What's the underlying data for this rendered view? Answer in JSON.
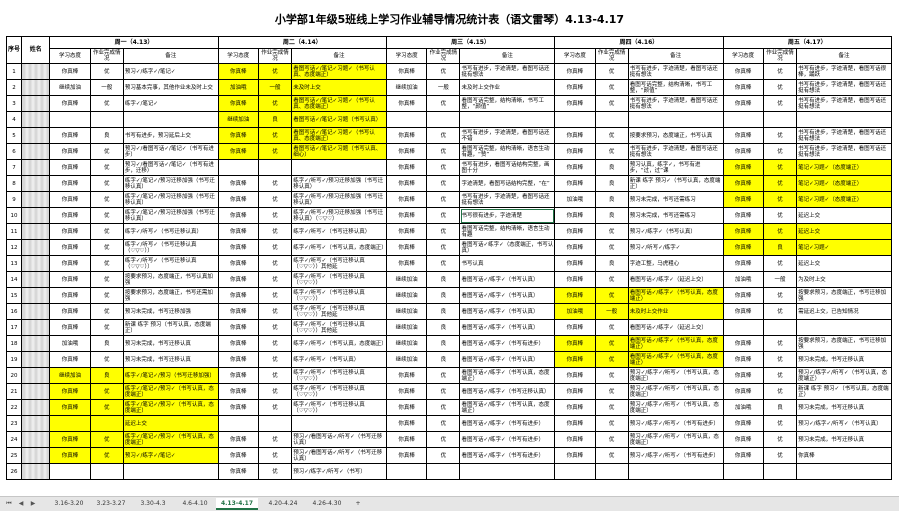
{
  "title": "小学部1年级5班线上学习作业辅导情况统计表（语文雷琴）4.13-4.17",
  "header": {
    "seq": "序号",
    "name": "姓名",
    "days": [
      "周一（4.13）",
      "周二（4.14）",
      "周三（4.15）",
      "周四（4.16）",
      "周五（4.17）"
    ],
    "sub": [
      "学习态度",
      "作业完成情况",
      "备注"
    ]
  },
  "rows": [
    {
      "no": "1",
      "cells": [
        [
          "你真棒",
          "优",
          "预习✓/练字✓/笔记✓"
        ],
        [
          "你真棒",
          "优",
          "看图写话✓/笔记✓习题✓（书写认真、态度端正）"
        ],
        [
          "你真棒",
          "优",
          "书写有进步，字迹清楚，看图写话还挺有想法"
        ],
        [
          "你真棒",
          "优",
          "书写有进步，字迹清楚，看图写话还挺有想法"
        ],
        [
          "你真棒",
          "优",
          "书写有进步，字迹清楚，看图写话很棒，踊跃"
        ]
      ]
    },
    {
      "no": "2",
      "cells": [
        [
          "继续加油",
          "一般",
          "预习基本完事，其他作业未及时上交"
        ],
        [
          "加油哦",
          "一般",
          "未及时上交"
        ],
        [
          "继续加油",
          "一般",
          "未及时上交作业"
        ],
        [
          "你真棒",
          "优",
          "看图写话完整，结构清晰，书写工整，“颜值”"
        ],
        [
          "你真棒",
          "优",
          "书写有进步，字迹清楚，看图写话还挺有想法"
        ]
      ]
    },
    {
      "no": "3",
      "cells": [
        [
          "你真棒",
          "优",
          "练字✓/笔记✓"
        ],
        [
          "你真棒",
          "优",
          "看图写话✓/笔记✓习题✓（书写认真、态度端正）"
        ],
        [
          "你真棒",
          "优",
          "看图写话完整，结构清晰，书写工整，“颜值”"
        ],
        [
          "你真棒",
          "优",
          "书写有进步，字迹清楚，看图写话还挺有想法"
        ],
        [
          "你真棒",
          "优",
          "书写有进步，字迹清楚，看图写话还挺有想法"
        ]
      ]
    },
    {
      "no": "4",
      "cells": [
        [
          "",
          "",
          ""
        ],
        [
          "继续加油",
          "良",
          "看图写话✓/笔记✓习题（书写认真）"
        ],
        [
          "",
          "",
          ""
        ],
        [
          "",
          "",
          ""
        ],
        [
          "",
          "",
          ""
        ]
      ]
    },
    {
      "no": "5",
      "cells": [
        [
          "你真棒",
          "良",
          "书写有进步，预习延后上交"
        ],
        [
          "你真棒",
          "优",
          "看图写话✓/笔记✓习题✓（书写认真、态度端正）"
        ],
        [
          "你真棒",
          "优",
          "书写有进步，字迹清楚，看图写话还不错"
        ],
        [
          "你真棒",
          "优",
          "按要求预习，态度端正，书写认真"
        ],
        [
          "你真棒",
          "优",
          "书写有进步，字迹清楚，看图写话还挺有想法"
        ]
      ]
    },
    {
      "no": "6",
      "cells": [
        [
          "你真棒",
          "优",
          "预习✓/看图写话✓/笔记✓（书写有进步）"
        ],
        [
          "你真棒",
          "优",
          "看图写话✓/笔记✓习题（书写认真、细心）"
        ],
        [
          "你真棒",
          "优",
          "看图写话完整，结构清晰，语言生动有趣，“赞”"
        ],
        [
          "你真棒",
          "优",
          "书写有进步，字迹清楚，看图写话还挺有想法"
        ],
        [
          "你真棒",
          "优",
          "书写有进步，字迹清楚，看图写话还挺有想法"
        ]
      ]
    },
    {
      "no": "7",
      "cells": [
        [
          "你真棒",
          "优",
          "预习✓/看图写话✓/笔记✓（书写有进步，迁移）"
        ],
        [
          "",
          "",
          ""
        ],
        [
          "你真棒",
          "优",
          "书写有进步，看图写话结构完整，画图十分"
        ],
        [
          "你真棒",
          "良",
          "预习认真，练字✓，书写有进步，“过，过”课"
        ],
        [
          "你真棒",
          "优",
          "笔记✓习题✓（态度端正）"
        ]
      ]
    },
    {
      "no": "8",
      "cells": [
        [
          "你真棒",
          "优",
          "练字✓/笔记✓/预习迁移加强（书写迁移认真）"
        ],
        [
          "你真棒",
          "优",
          "练字✓/听写✓/预习迁移加强（书写迁移认真）"
        ],
        [
          "你真棒",
          "优",
          "字迹清楚，看图写话结构完整，“在”"
        ],
        [
          "你真棒",
          "良",
          "新课 练字 预习✓（书写认真，态度端正）"
        ],
        [
          "你真棒",
          "优",
          "笔记✓习题✓（态度端正）"
        ]
      ]
    },
    {
      "no": "9",
      "cells": [
        [
          "你真棒",
          "优",
          "练字✓/笔记✓/预习迁移加强（书写迁移认真）"
        ],
        [
          "你真棒",
          "优",
          "练字✓/听写✓/预习迁移加强（书写迁移认真）"
        ],
        [
          "你真棒",
          "优",
          "书写有进步，字迹清楚，看图写话还挺有想法"
        ],
        [
          "加油哦",
          "良",
          "预习未完成，书写还需练习"
        ],
        [
          "你真棒",
          "优",
          "笔记✓习题✓（态度端正）"
        ]
      ]
    },
    {
      "no": "10",
      "cells": [
        [
          "你真棒",
          "优",
          "练字✓/笔记✓/预习迁移加强（书写迁移认真）"
        ],
        [
          "你真棒",
          "优",
          "练字✓/听写✓/预习迁移加强（书写迁移认真）（♡▽♡）"
        ],
        [
          "你真棒",
          "优",
          "书写很有进步，字迹清楚"
        ],
        [
          "你真棒",
          "良",
          "预习未完成，书写还需练习"
        ],
        [
          "你真棒",
          "优",
          "延迟上交"
        ]
      ]
    },
    {
      "no": "11",
      "cells": [
        [
          "你真棒",
          "优",
          "练字✓/听写✓（书写迁移认真）"
        ],
        [
          "你真棒",
          "优",
          "练字✓/听写✓（书写迁移认真）"
        ],
        [
          "你真棒",
          "优",
          "看图写话完整，结构清晰，语言生动有趣"
        ],
        [
          "你真棒",
          "优",
          "预习✓/练字✓（书写认真）"
        ],
        [
          "你真棒",
          "优",
          "延迟上交"
        ]
      ]
    },
    {
      "no": "12",
      "cells": [
        [
          "你真棒",
          "优",
          "练字✓/听写✓（书写迁移认真（♡▽♡））"
        ],
        [
          "你真棒",
          "优",
          "练字✓/听写✓（书写认真，态度端正）"
        ],
        [
          "你真棒",
          "优",
          "看图写话✓练字✓（态度端正，书写认真）"
        ],
        [
          "你真棒",
          "优",
          "预习✓/听写✓/练字✓"
        ],
        [
          "你真棒",
          "良",
          "笔记✓习题✓"
        ]
      ]
    },
    {
      "no": "13",
      "cells": [
        [
          "你真棒",
          "优",
          "练字✓/听写✓（书写迁移认真（♡▽♡））"
        ],
        [
          "你真棒",
          "优",
          "练字✓/听写✓（书写迁移认真（♡▽♡））其他延"
        ],
        [
          "你真棒",
          "优",
          "书写认真"
        ],
        [
          "你真棒",
          "良",
          "字迹工整，马虎粗心"
        ],
        [
          "你真棒",
          "优",
          "延迟上交"
        ]
      ]
    },
    {
      "no": "14",
      "cells": [
        [
          "你真棒",
          "优",
          "按要求预习，态度端正，书写认真加强"
        ],
        [
          "你真棒",
          "优",
          "练字✓/听写✓（书写迁移认真（♡▽♡））"
        ],
        [
          "继续加油",
          "良",
          "看图写话✓/练字✓（书写认真）"
        ],
        [
          "你真棒",
          "优",
          "看图写话✓/练字✓（延迟上交）"
        ],
        [
          "加油哦",
          "一般",
          "为及时上交"
        ]
      ]
    },
    {
      "no": "15",
      "cells": [
        [
          "你真棒",
          "优",
          "按要求预习，态度端正，书写还需加强"
        ],
        [
          "你真棒",
          "优",
          "练字✓/听写✓（书写迁移认真（♡▽♡））"
        ],
        [
          "继续加油",
          "良",
          "看图写话✓/练字✓（书写认真）"
        ],
        [
          "你真棒",
          "优",
          "看图写话✓/练字✓（书写认真，态度端正）"
        ],
        [
          "你真棒",
          "优",
          "按要求预习，态度端正，书写迁移加强"
        ]
      ]
    },
    {
      "no": "16",
      "cells": [
        [
          "你真棒",
          "优",
          "预习未完成，书写迁移加强"
        ],
        [
          "你真棒",
          "优",
          "练字✓/听写✓（书写迁移认真（♡▽♡））其他延"
        ],
        [
          "继续加油",
          "良",
          "看图写话✓/练字✓（书写认真）"
        ],
        [
          "加油哦",
          "一般",
          "未及时上交作业"
        ],
        [
          "你真棒",
          "优",
          "需延迟上交，已告知情况"
        ]
      ]
    },
    {
      "no": "17",
      "cells": [
        [
          "你真棒",
          "优",
          "新课 练字 预习（书写认真，态度端正）"
        ],
        [
          "你真棒",
          "优",
          "练字✓/听写✓（书写迁移认真（♡▽♡））其他延"
        ],
        [
          "继续加油",
          "良",
          "看图写话✓/练字✓（书写认真）"
        ],
        [
          "你真棒",
          "优",
          "看图写话✓/练字✓（延迟上交）"
        ],
        [
          "",
          "",
          ""
        ]
      ]
    },
    {
      "no": "18",
      "cells": [
        [
          "加油哦",
          "良",
          "预习未完成，书写迁移认真"
        ],
        [
          "你真棒",
          "优",
          "练字✓/听写✓（书写认真，态度端正）"
        ],
        [
          "继续加油",
          "良",
          "看图写话✓/练字✓（书写有进步）"
        ],
        [
          "你真棒",
          "优",
          "看图写话✓/练字✓（书写认真，态度端正）"
        ],
        [
          "你真棒",
          "优",
          "按要求预习，态度端正，书写迁移加强"
        ]
      ]
    },
    {
      "no": "19",
      "cells": [
        [
          "你真棒",
          "优",
          "预习未完成，书写迁移认真"
        ],
        [
          "你真棒",
          "优",
          "练字✓/听写✓（书写认真）"
        ],
        [
          "继续加油",
          "良",
          "看图写话✓/练字✓（书写认真）"
        ],
        [
          "你真棒",
          "优",
          "看图写话✓/练字✓（书写认真，态度端正）"
        ],
        [
          "你真棒",
          "优",
          "预习未完成，书写迁移认真"
        ]
      ]
    },
    {
      "no": "20",
      "cells": [
        [
          "继续加油",
          "良",
          "练字✓/笔记✓/预习（书写迁移加强）"
        ],
        [
          "你真棒",
          "优",
          "练字✓/听写✓（书写迁移认真（♡▽♡））"
        ],
        [
          "你真棒",
          "优",
          "看图写话✓/练字✓（书写认真，态度端正）"
        ],
        [
          "你真棒",
          "优",
          "预习✓/练字✓/听写✓（书写认真，态度端正）"
        ],
        [
          "你真棒",
          "优",
          "预习✓/练字✓/听写✓（书写认真，态度端正）"
        ]
      ]
    },
    {
      "no": "21",
      "cells": [
        [
          "你真棒",
          "优",
          "练字✓/笔记✓/预习✓（书写认真，态度端正）"
        ],
        [
          "你真棒",
          "优",
          "练字✓/听写✓（书写迁移认真（♡▽♡））"
        ],
        [
          "你真棒",
          "优",
          "看图写话✓/练字✓（书写迁移认真）"
        ],
        [
          "你真棒",
          "优",
          "预习✓/练字✓/听写✓（书写认真，态度端正）"
        ],
        [
          "你真棒",
          "优",
          "新课 练字 预习✓（书写认真，态度端正）"
        ]
      ]
    },
    {
      "no": "22",
      "cells": [
        [
          "你真棒",
          "优",
          "练字✓/笔记✓/预习✓（书写认真，态度端正）"
        ],
        [
          "你真棒",
          "优",
          "练字✓/听写✓（书写迁移认真（♡▽♡））"
        ],
        [
          "你真棒",
          "优",
          "看图写话✓/练字✓（书写认真，态度端正）"
        ],
        [
          "你真棒",
          "优",
          "预习✓/练字✓/听写✓（书写认真，态度端正）"
        ],
        [
          "加油哦",
          "良",
          "预习未完成，书写迁移认真"
        ]
      ]
    },
    {
      "no": "23",
      "cells": [
        [
          "",
          "",
          "延迟上交"
        ],
        [
          "",
          "",
          ""
        ],
        [
          "你真棒",
          "优",
          "看图写话✓/练字✓（书写有进步）"
        ],
        [
          "你真棒",
          "优",
          "预习✓/练字✓/听写✓（书写有进步）"
        ],
        [
          "你真棒",
          "优",
          "预习✓/练字✓/听写✓（书写认真）"
        ]
      ]
    },
    {
      "no": "24",
      "cells": [
        [
          "你真棒",
          "优",
          "练字✓/笔记✓/预习✓（书写认真，态度端正）"
        ],
        [
          "你真棒",
          "优",
          "预习✓/看图写话✓/听写✓（书写迁移认真）"
        ],
        [
          "你真棒",
          "优",
          "看图写话✓/练字✓（书写有进步）"
        ],
        [
          "你真棒",
          "优",
          "预习✓/练字✓/听写✓（书写认真，态度端正）"
        ],
        [
          "你真棒",
          "优",
          "预习未完成，书写迁移认真"
        ]
      ]
    },
    {
      "no": "25",
      "cells": [
        [
          "你真棒",
          "优",
          "预习✓/练字✓/笔记✓"
        ],
        [
          "你真棒",
          "优",
          "预习✓/看图写话✓/听写✓（书写迁移认真）"
        ],
        [
          "你真棒",
          "优",
          "看图写话✓/练字✓（书写有进步）"
        ],
        [
          "你真棒",
          "优",
          "预习✓/练字✓/听写✓（书写有进步）"
        ],
        [
          "你真棒",
          "优",
          "你真棒"
        ]
      ]
    },
    {
      "no": "26",
      "cells": [
        [
          "",
          "",
          ""
        ],
        [
          "你真棒",
          "优",
          "预习✓/练字✓/听写✓（书写）"
        ],
        [
          "",
          "",
          ""
        ],
        [
          "",
          "",
          ""
        ],
        [
          "",
          "",
          ""
        ]
      ]
    }
  ],
  "sheet_tabs": [
    "3.16-3.20",
    "3.23-3.27",
    "3.30-4.3",
    "4.6-4.10",
    "4.13-4.17",
    "4.20-4.24",
    "4.26-4.30"
  ],
  "active_tab": "4.13-4.17",
  "add_sheet_label": "+",
  "colors": {
    "highlight": "#ffff00",
    "active_tab": "#217346",
    "tab_bar": "#e6e6e6"
  }
}
